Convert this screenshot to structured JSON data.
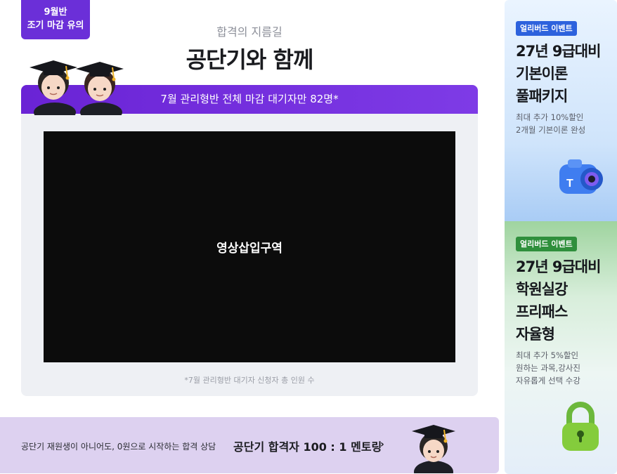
{
  "badge": {
    "line1": "9월반",
    "line2": "조기 마감 유의"
  },
  "header": {
    "subtitle": "합격의 지름길",
    "title": "공단기와 함께"
  },
  "card": {
    "banner": "7월 관리형반 전체 마감 대기자만 82명*",
    "video_label": "영상삽입구역",
    "footnote": "*7월 관리형반 대기자 신청자 총 인원 수"
  },
  "bottom_banner": {
    "small_text": "공단기 재원생이 아니어도, 0원으로 시작하는 합격 상담",
    "big_text": "공단기 합격자 100 : 1 멘토링",
    "arrow": "›"
  },
  "side_events": [
    {
      "tag": "얼리버드 이벤트",
      "title_lines": [
        "27년 9급대비",
        "기본이론",
        "풀패키지"
      ],
      "desc_lines": [
        "최대 추가 10%할인",
        "2개월 기본이론 완성"
      ],
      "icon": "camera-icon",
      "accent": "#2d62dd"
    },
    {
      "tag": "얼리버드 이벤트",
      "title_lines": [
        "27년 9급대비",
        "학원실강",
        "프리패스",
        "자율형"
      ],
      "desc_lines": [
        "최대 추가 5%할인",
        "원하는 과목,강사진",
        "자유롭게 선택 수강"
      ],
      "icon": "lock-icon",
      "accent": "#2f8f3c"
    }
  ],
  "colors": {
    "primary": "#6b2fd8",
    "banner_bg": "#ddd1f0",
    "card_bg": "#eef0f4"
  }
}
